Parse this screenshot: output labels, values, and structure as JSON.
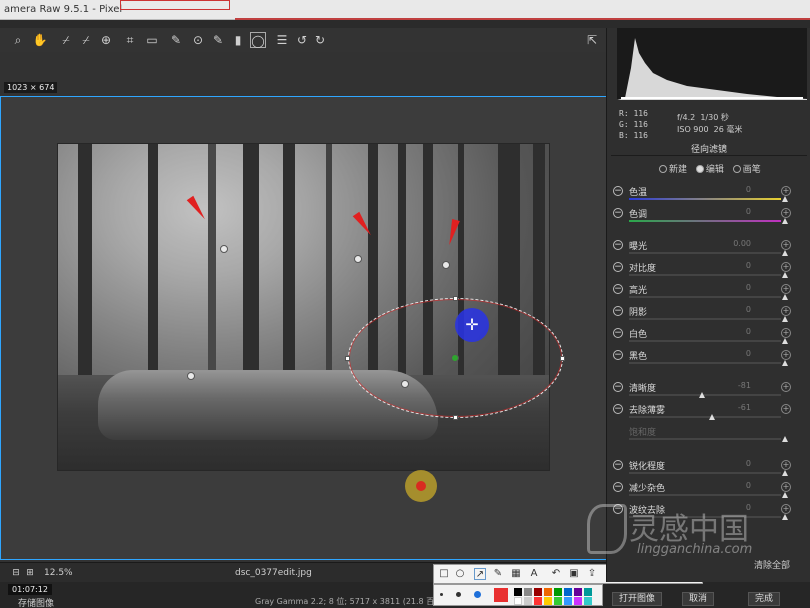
{
  "window": {
    "title": "amera Raw 9.5.1 - Pixel"
  },
  "overlay": {
    "dimension_label": "1023 × 674"
  },
  "statusbar": {
    "zoom": "12.5%",
    "filename": "dsc_0377edit.jpg"
  },
  "bottombar": {
    "timer": "01:07:12",
    "save_image": "存储图像",
    "info": "Gray Gamma 2.2; 8 位; 5717 x 3811 (21.8 百万像素); 300 ppi",
    "open_image": "打开图像",
    "cancel": "取消",
    "done": "完成"
  },
  "snip": {
    "done": "完成"
  },
  "panel": {
    "rgb": {
      "r": "R:  116",
      "g": "G:  116",
      "b": "B:  116"
    },
    "camera": {
      "aperture": "f/4.2",
      "shutter": "1/30 秒",
      "iso": "ISO 900",
      "focal": "26 毫米"
    },
    "title": "径向滤镜",
    "modes": {
      "new": "新建",
      "edit": "编辑",
      "brush": "画笔"
    },
    "sliders": [
      {
        "label": "色温",
        "value": "0"
      },
      {
        "label": "色调",
        "value": "0"
      },
      {
        "label": "曝光",
        "value": "0.00"
      },
      {
        "label": "对比度",
        "value": "0"
      },
      {
        "label": "高光",
        "value": "0"
      },
      {
        "label": "阴影",
        "value": "0"
      },
      {
        "label": "白色",
        "value": "0"
      },
      {
        "label": "黑色",
        "value": "0"
      },
      {
        "label": "清晰度",
        "value": "-81"
      },
      {
        "label": "去除薄雾",
        "value": "-61"
      },
      {
        "label": "饱和度",
        "value": ""
      },
      {
        "label": "锐化程度",
        "value": "0"
      },
      {
        "label": "减少杂色",
        "value": "0"
      },
      {
        "label": "波纹去除",
        "value": "0"
      }
    ],
    "clear_all": "清除全部"
  },
  "watermark": {
    "zh": "灵感中国",
    "en": "lingganchina.com"
  },
  "colors": {
    "accent": "#2fa6ff",
    "arrow": "#e02020",
    "pin_blue": "#2832e6",
    "pin_green": "#2fa52f"
  }
}
